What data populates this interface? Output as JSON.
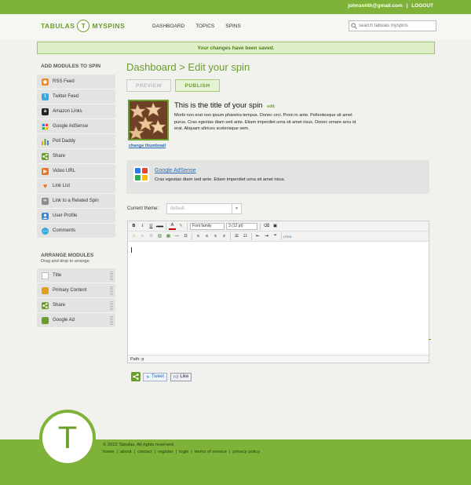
{
  "account": {
    "email": "johnsmith@gmail.com",
    "separator": "|",
    "logout": "LOGOUT"
  },
  "brand": {
    "left": "TABULAS",
    "mark": "T",
    "right": "MYSPINS"
  },
  "nav": [
    "DASHBOARD",
    "TOPICS",
    "SPINS"
  ],
  "search": {
    "placeholder": "search tabulas myspins"
  },
  "notice": "Your changes have been saved.",
  "sidebar": {
    "add_title": "ADD MODULES TO SPIN",
    "modules": [
      {
        "label": "RSS Feed",
        "icon": "rss-icon",
        "color": "#f08a24"
      },
      {
        "label": "Twitter Feed",
        "icon": "twitter-icon",
        "color": "#3aa7e0"
      },
      {
        "label": "Amazon Links",
        "icon": "amazon-icon",
        "color": "#222222"
      },
      {
        "label": "Google AdSense",
        "icon": "adsense-icon",
        "color": "#e5e5e5"
      },
      {
        "label": "Poll Daddy",
        "icon": "poll-icon",
        "color": "#e2a021"
      },
      {
        "label": "Share",
        "icon": "share-icon",
        "color": "#6b9d2a"
      },
      {
        "label": "Video URL",
        "icon": "video-icon",
        "color": "#e8742a"
      },
      {
        "label": "Link List",
        "icon": "heart-icon",
        "color": "#e8742a"
      },
      {
        "label": "Link to a Related Spin",
        "icon": "link-icon",
        "color": "#8c8c8c"
      },
      {
        "label": "User Profile",
        "icon": "user-icon",
        "color": "#3a86d6"
      },
      {
        "label": "Comments",
        "icon": "comment-icon",
        "color": "#3aa7e0"
      }
    ],
    "arrange_title": "ARRANGE MODULES",
    "arrange_sub": "Drag and drop to arrange",
    "arrange": [
      {
        "label": "Title",
        "icon": "title-icon",
        "color": "#dcdcdc"
      },
      {
        "label": "Primary Content",
        "icon": "content-icon",
        "color": "#e2a021"
      },
      {
        "label": "Share",
        "icon": "share-icon",
        "color": "#6b9d2a"
      },
      {
        "label": "Google Ad",
        "icon": "adsense-icon",
        "color": "#6b9d2a"
      }
    ]
  },
  "page": {
    "title": "Dashboard > Edit your spin",
    "preview": "PREVIEW",
    "publish": "PUBLISH",
    "change_thumb": "change thumbnail",
    "spin_title": "This is the title of your spin",
    "edit": "edit",
    "spin_desc": "Morbi non erat non ipsum pharetra tempus. Donec orci. Proin in ante. Pellentesque sit amet purus. Cras egestas diam sed ante. Etiam imperdiet urna sit amet risus. Donec ornare arcu id erat. Aliquam ultrices scelerisque sem.",
    "ad_title": "Google AdSense",
    "ad_desc": "Cras egestas diam sed ante. Etiam imperdiet urna sit amet risus.",
    "theme_label": "Current theme:",
    "theme_value": "default",
    "font_family": "Font family",
    "font_size": "3 (12 pt)",
    "path": "Path: p",
    "tweet": "Tweet",
    "like": "Like"
  },
  "footer": {
    "mark": "T",
    "copyright": "© 2012 Tabulas. All rights reserved.",
    "links": [
      "home",
      "about",
      "contact",
      "register",
      "login",
      "terms of service",
      "privacy policy"
    ]
  }
}
